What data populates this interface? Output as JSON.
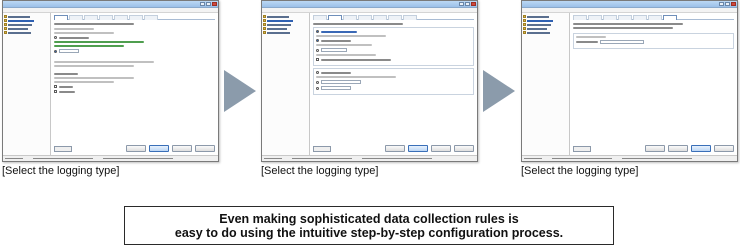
{
  "steps": [
    {
      "caption": "[Select the logging type]"
    },
    {
      "caption": "[Select the logging type]"
    },
    {
      "caption": "[Select the logging type]"
    }
  ],
  "notice": {
    "line1": "Even making sophisticated data collection rules is",
    "line2": "easy to do using the intuitive step-by-step configuration process."
  },
  "colors": {
    "arrow": "#8b9bab",
    "accent": "#3a68b5"
  },
  "icons": {
    "arrow": "right-arrow-icon"
  }
}
